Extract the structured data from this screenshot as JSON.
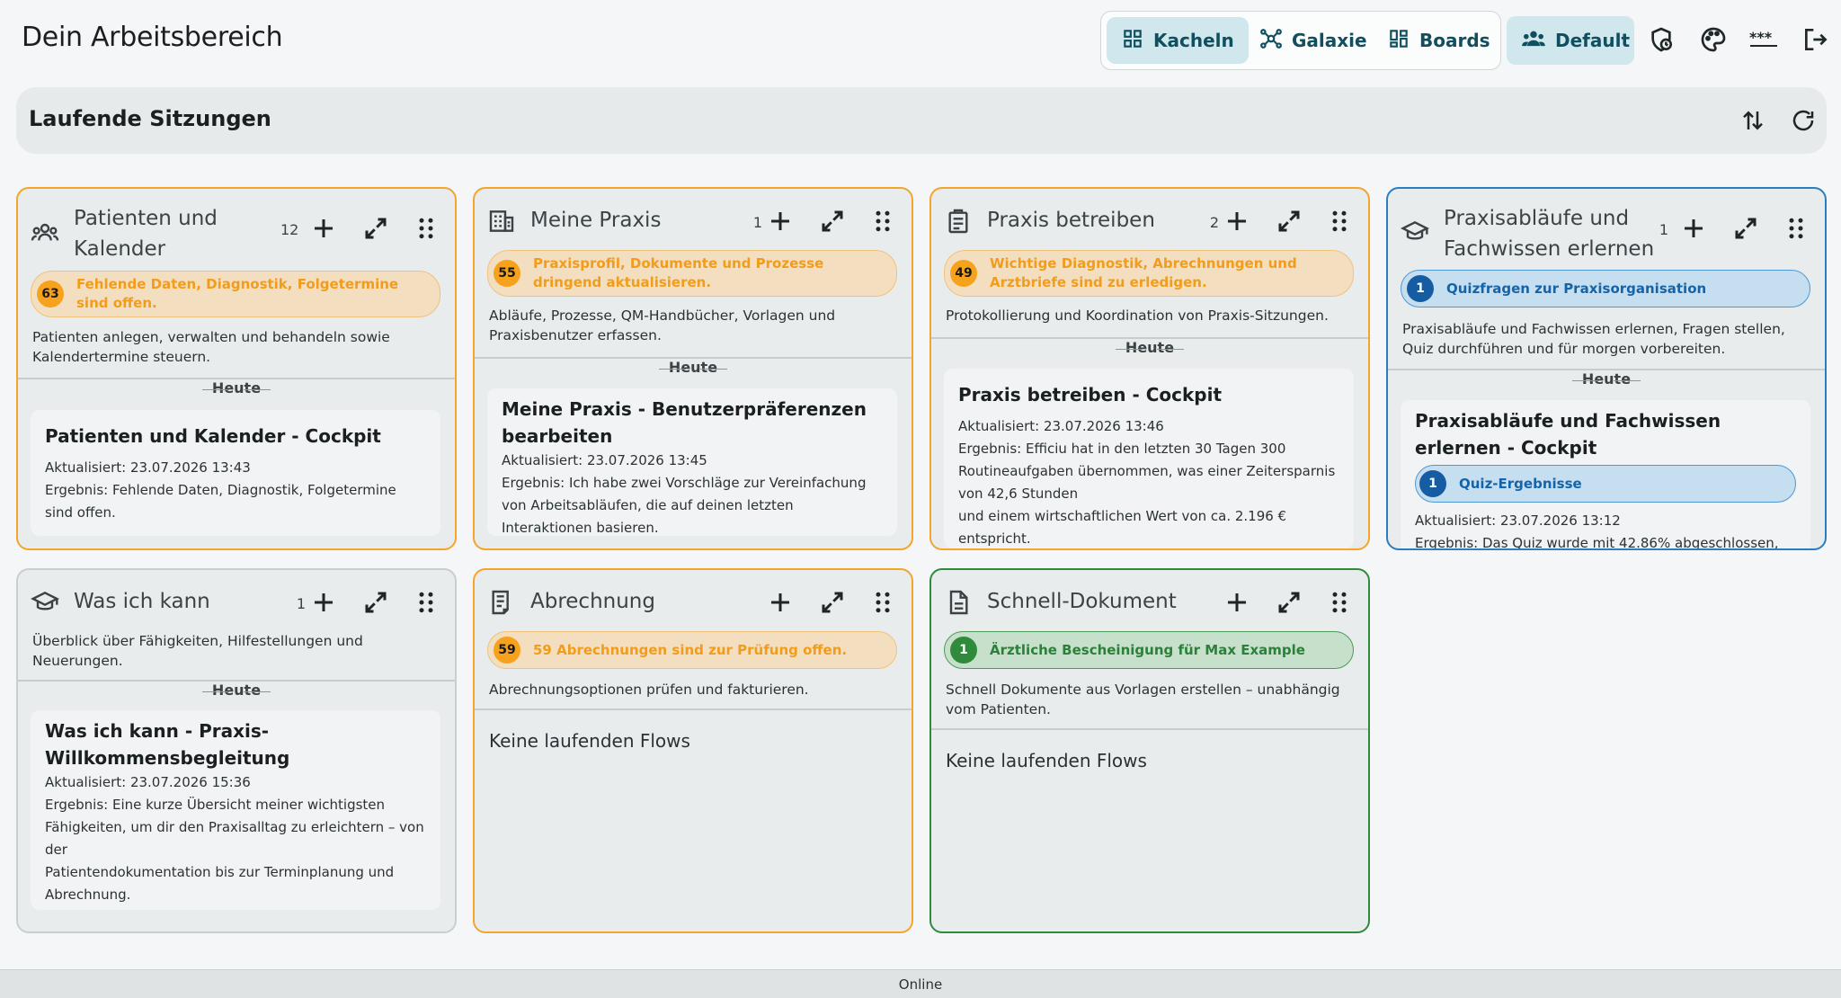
{
  "header": {
    "title": "Dein Arbeitsbereich",
    "views": [
      {
        "label": "Kacheln",
        "icon": "grid-icon",
        "active": true
      },
      {
        "label": "Galaxie",
        "icon": "galaxy-icon",
        "active": false
      },
      {
        "label": "Boards",
        "icon": "boards-icon",
        "active": false
      }
    ],
    "profile_label": "Default",
    "icons": [
      "shield-clock-icon",
      "palette-icon",
      "password-icon",
      "logout-icon"
    ]
  },
  "sessions": {
    "title": "Laufende Sitzungen",
    "icons": [
      "sort-icon",
      "refresh-icon"
    ]
  },
  "cards": [
    {
      "title": "Patienten und Kalender",
      "count": "12",
      "alert_num": "63",
      "alert_text": "Fehlende Daten, Diagnostik, Folgetermine sind offen.",
      "desc": "Patienten anlegen, verwalten und behandeln sowie Kalendertermine steuern.",
      "day": "Heute",
      "session_title": "Patienten und Kalender - Cockpit",
      "updated": "Aktualisiert: 23.07.2026 13:43",
      "result": "Ergebnis: Fehlende Daten, Diagnostik, Folgetermine sind offen."
    },
    {
      "title": "Meine Praxis",
      "count": "1",
      "alert_num": "55",
      "alert_text": "Praxisprofil, Dokumente und Prozesse dringend aktualisieren.",
      "desc": "Abläufe, Prozesse, QM-Handbücher, Vorlagen und Praxisbenutzer erfassen.",
      "day": "Heute",
      "session_title": "Meine Praxis - Benutzerpräferenzen bearbeiten",
      "updated": "Aktualisiert: 23.07.2026 13:45",
      "result": "Ergebnis: Ich habe zwei Vorschläge zur Vereinfachung von Arbeitsabläufen, die auf deinen letzten Interaktionen basieren."
    },
    {
      "title": "Praxis betreiben",
      "count": "2",
      "alert_num": "49",
      "alert_text": "Wichtige Diagnostik, Abrechnungen und Arztbriefe sind zu erledigen.",
      "desc": "Protokollierung und Koordination von Praxis-Sitzungen.",
      "day": "Heute",
      "session_title": "Praxis betreiben - Cockpit",
      "updated": "Aktualisiert: 23.07.2026 13:46",
      "result": "Ergebnis: Efficiu hat in den letzten 30 Tagen 300 Routineaufgaben übernommen, was einer Zeitersparnis von 42,6 Stunden",
      "result2": "und einem wirtschaftlichen Wert von ca. 2.196 € entspricht."
    },
    {
      "title": "Praxisabläufe und Fachwissen erlernen",
      "count": "1",
      "alert_num": "1",
      "alert_text": "Quizfragen zur Praxisorganisation",
      "desc": "Praxisabläufe und Fachwissen erlernen, Fragen stellen, Quiz durchführen und für morgen vorbereiten.",
      "day": "Heute",
      "session_title": "Praxisabläufe und Fachwissen erlernen - Cockpit",
      "sub_alert_num": "1",
      "sub_alert_text": "Quiz-Ergebnisse",
      "updated": "Aktualisiert: 23.07.2026 13:12",
      "result": "Ergebnis: Das Quiz wurde mit 42.86% abgeschlossen,"
    },
    {
      "title": "Was ich kann",
      "count": "1",
      "desc": "Überblick über Fähigkeiten, Hilfestellungen und Neuerungen.",
      "day": "Heute",
      "session_title": "Was ich kann - Praxis-Willkommensbegleitung",
      "updated": "Aktualisiert: 23.07.2026 15:36",
      "result": "Ergebnis: Eine kurze Übersicht meiner wichtigsten Fähigkeiten, um dir den Praxisalltag zu erleichtern – von der",
      "result2": "Patientendokumentation bis zur Terminplanung und Abrechnung."
    },
    {
      "title": "Abrechnung",
      "alert_num": "59",
      "alert_text": "59 Abrechnungen sind zur Prüfung offen.",
      "desc": "Abrechnungsoptionen prüfen und fakturieren.",
      "empty": "Keine laufenden Flows"
    },
    {
      "title": "Schnell-Dokument",
      "alert_num": "1",
      "alert_text": "Ärztliche Bescheinigung für Max Example",
      "desc": "Schnell Dokumente aus Vorlagen erstellen – unabhängig vom Patienten.",
      "empty": "Keine laufenden Flows"
    }
  ],
  "footer": {
    "status": "Online"
  }
}
